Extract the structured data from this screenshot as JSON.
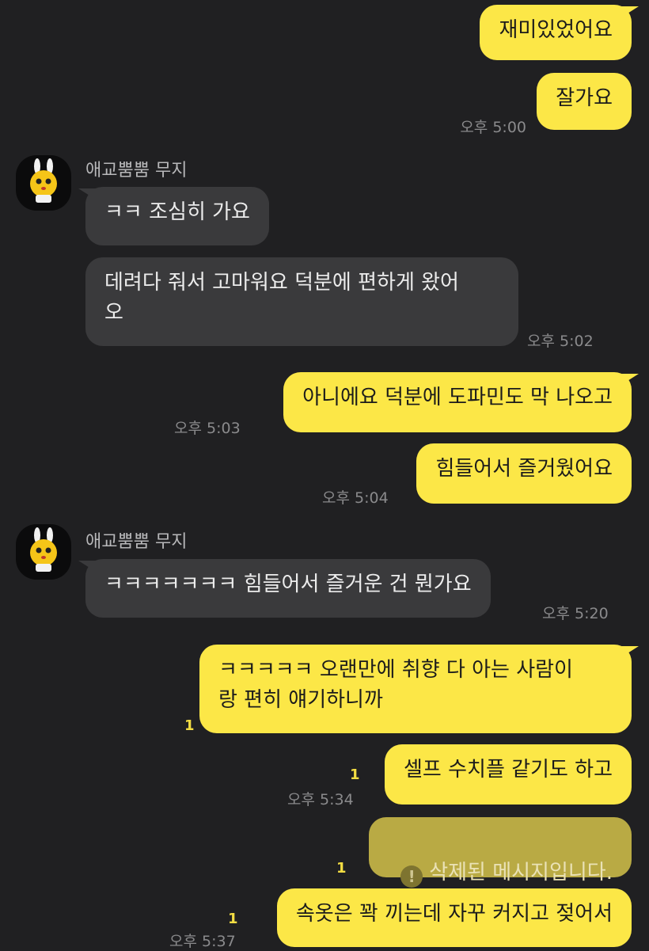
{
  "theme": {
    "background": "#202022",
    "my_bubble": "#fce747",
    "their_bubble": "#3a3a3c",
    "unread_color": "#f3dd43"
  },
  "messages": {
    "m1": {
      "text": "재미있었어요"
    },
    "m2": {
      "text": "잘가요",
      "time": "오후 5:00"
    },
    "m3": {
      "sender": "애교뿜뿜 무지",
      "text": "ㅋㅋ 조심히 가요"
    },
    "m4": {
      "text": "데려다 줘서 고마워요 덕분에 편하게 왔어\n오",
      "time": "오후 5:02"
    },
    "m5": {
      "text": "아니에요 덕분에 도파민도 막 나오고",
      "time": "오후 5:03"
    },
    "m6": {
      "text": "힘들어서 즐거웠어요",
      "time": "오후 5:04"
    },
    "m7": {
      "sender": "애교뿜뿜 무지",
      "text": "ㅋㅋㅋㅋㅋㅋㅋ 힘들어서 즐거운 건 뭔가요",
      "time": "오후 5:20"
    },
    "m8": {
      "text": "ㅋㅋㅋㅋㅋ 오랜만에 취향 다 아는 사람이\n랑 편히 얘기하니까",
      "unread": "1"
    },
    "m9": {
      "text": "셀프 수치플 같기도 하고",
      "unread": "1",
      "time": "오후 5:34"
    },
    "m10": {
      "text": "삭제된 메시지입니다.",
      "icon": "exclamation-circle-icon",
      "unread": "1"
    },
    "m11": {
      "text": "속옷은 꽉 끼는데 자꾸 커지고 젖어서",
      "unread": "1",
      "time": "오후 5:37"
    }
  }
}
